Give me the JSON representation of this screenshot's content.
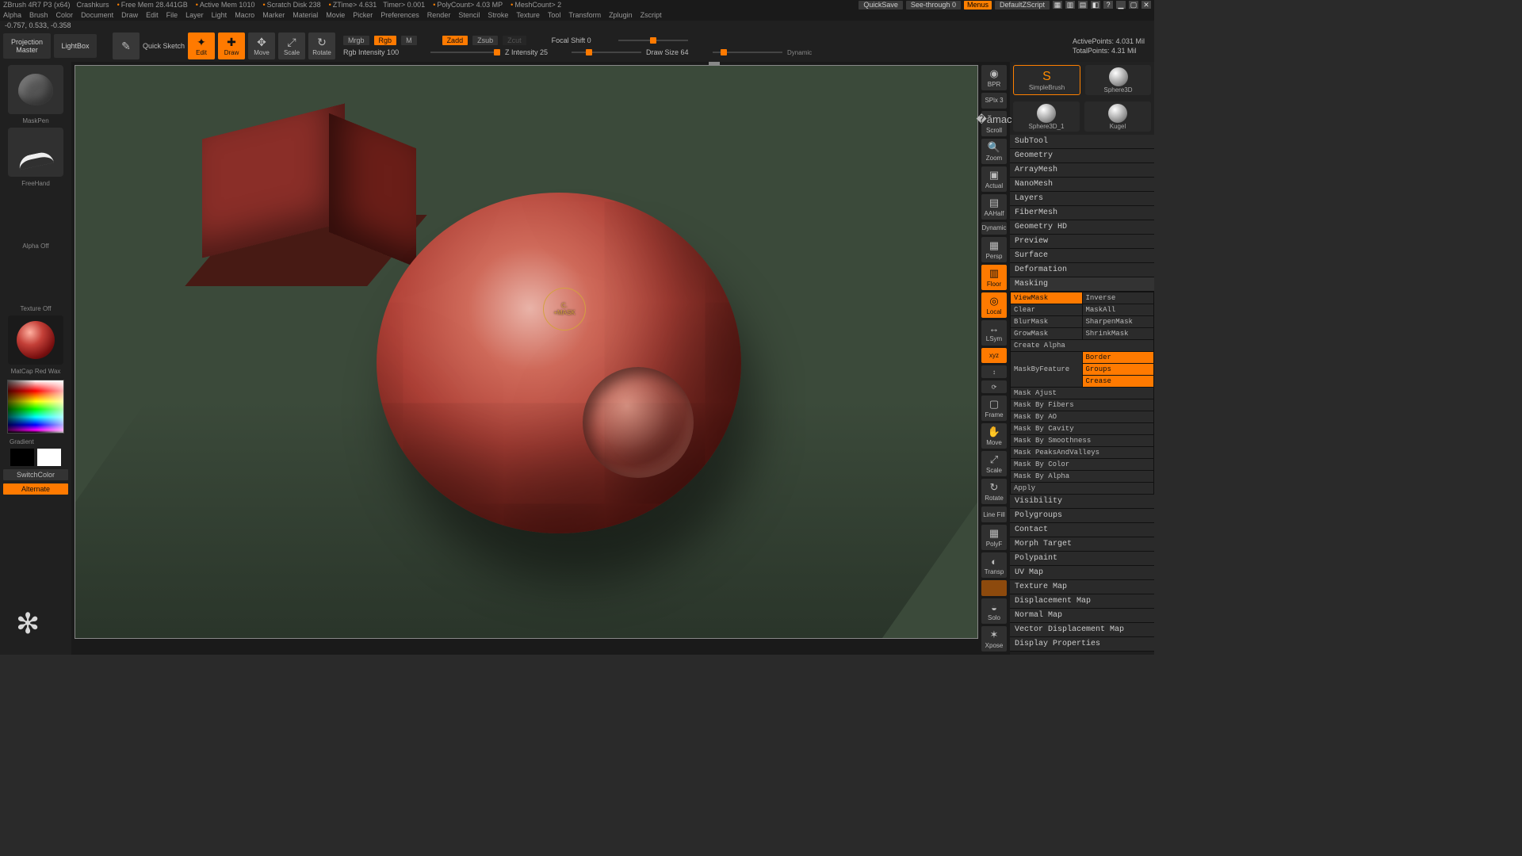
{
  "info": {
    "app": "ZBrush 4R7 P3 (x64)",
    "project": "Crashkurs",
    "freemem": "Free Mem 28.441GB",
    "activemem": "Active Mem 1010",
    "scratch": "Scratch Disk 238",
    "ztime": "ZTime> 4.631",
    "timer": "Timer> 0.001",
    "poly": "PolyCount> 4.03 MP",
    "mesh": "MeshCount> 2",
    "quicksave": "QuickSave",
    "seethrough": "See-through  0",
    "menus": "Menus",
    "script": "DefaultZScript"
  },
  "menus": [
    "Alpha",
    "Brush",
    "Color",
    "Document",
    "Draw",
    "Edit",
    "File",
    "Layer",
    "Light",
    "Macro",
    "Marker",
    "Material",
    "Movie",
    "Picker",
    "Preferences",
    "Render",
    "Stencil",
    "Stroke",
    "Texture",
    "Tool",
    "Transform",
    "Zplugin",
    "Zscript"
  ],
  "status": "-0.757, 0.533, -0.358",
  "tb": {
    "projection1": "Projection",
    "projection2": "Master",
    "lightbox": "LightBox",
    "quicksketch": "Quick\nSketch",
    "edit": "Edit",
    "draw": "Draw",
    "move": "Move",
    "scale": "Scale",
    "rotate": "Rotate",
    "mrgb": "Mrgb",
    "rgb": "Rgb",
    "m": "M",
    "zadd": "Zadd",
    "zsub": "Zsub",
    "zcut": "Zcut",
    "rgbint": "Rgb Intensity 100",
    "zint": "Z Intensity 25",
    "focal": "Focal Shift 0",
    "drawsize": "Draw Size 64",
    "dynamic": "Dynamic",
    "activepts": "ActivePoints: 4.031 Mil",
    "totalpts": "TotalPoints: 4.31 Mil"
  },
  "left": {
    "brush": "MaskPen",
    "stroke": "FreeHand",
    "alpha": "Alpha Off",
    "texture": "Texture Off",
    "material": "MatCap Red Wax",
    "gradient": "Gradient",
    "switch": "SwitchColor",
    "alternate": "Alternate"
  },
  "cursor": {
    "line1": "C.",
    "line2": "+MASK"
  },
  "rrail": {
    "bprv": "BPR",
    "spix": "SPix 3",
    "scroll": "Scroll",
    "zoom": "Zoom",
    "actual": "Actual",
    "aahalf": "AAHalf",
    "dynp": "Dynamic",
    "persp": "Persp",
    "floor": "Floor",
    "local": "Local",
    "lsym": "LSym",
    "xyz": "xyz",
    "frame": "Frame",
    "movep": "Move",
    "scalep": "Scale",
    "rotp": "Rotate",
    "linefill": "Line Fill",
    "polyf": "PolyF",
    "transp": "Transp",
    "ghost": "Solo",
    "xpose": "Xpose"
  },
  "rpanel": {
    "slot_a": "SimpleBrush",
    "slot_b": "Sphere3D",
    "slot_c": "Sphere3D_1",
    "slot_d": "Kugel",
    "acc": [
      "SubTool",
      "Geometry",
      "ArrayMesh",
      "NanoMesh",
      "Layers",
      "FiberMesh",
      "Geometry HD",
      "Preview",
      "Surface",
      "Deformation"
    ],
    "masking": "Masking",
    "view": "ViewMask",
    "inverse": "Inverse",
    "clear": "Clear",
    "maskall": "MaskAll",
    "blur": "BlurMask",
    "sharpen": "SharpenMask",
    "grow": "GrowMask",
    "shrink": "ShrinkMask",
    "createalpha": "Create Alpha",
    "mbf": "MaskByFeature",
    "border": "Border",
    "groups": "Groups",
    "crease": "Crease",
    "madjust": "Mask Ajust",
    "mfibers": "Mask By Fibers",
    "mao": "Mask By AO",
    "mcavity": "Mask By Cavity",
    "msmooth": "Mask By Smoothness",
    "mpeaks": "Mask PeaksAndValleys",
    "mcolor": "Mask By Color",
    "malpha": "Mask By Alpha",
    "apply": "Apply",
    "tail": [
      "Visibility",
      "Polygroups",
      "Contact",
      "Morph Target",
      "Polypaint",
      "UV Map",
      "Texture Map",
      "Displacement Map",
      "Normal Map",
      "Vector Displacement Map",
      "Display Properties"
    ]
  }
}
